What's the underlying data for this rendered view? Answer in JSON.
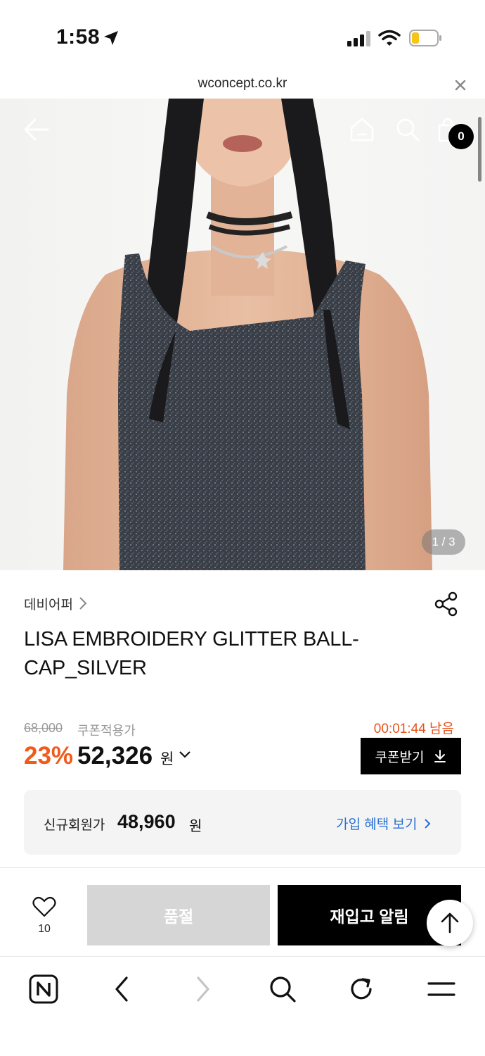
{
  "status_bar": {
    "time": "1:58"
  },
  "url_bar": {
    "url": "wconcept.co.kr"
  },
  "header": {
    "cart_count": "0"
  },
  "gallery": {
    "counter": "1 / 3"
  },
  "product": {
    "brand": "데비어퍼",
    "title": "LISA EMBROIDERY GLITTER BALL-CAP_SILVER",
    "original_price": "68,000",
    "coupon_label": "쿠폰적용가",
    "countdown": "00:01:44 남음",
    "discount": "23%",
    "sale_price": "52,326",
    "currency": "원",
    "coupon_button": "쿠폰받기"
  },
  "member": {
    "label": "신규회원가",
    "price": "48,960",
    "currency": "원",
    "link": "가입 혜택 보기"
  },
  "action_bar": {
    "like_count": "10",
    "soldout_label": "품절",
    "restock_label": "재입고 알림"
  },
  "colors": {
    "accent_orange": "#f05a1a",
    "link_blue": "#2a6fd1",
    "dark": "#000000"
  }
}
